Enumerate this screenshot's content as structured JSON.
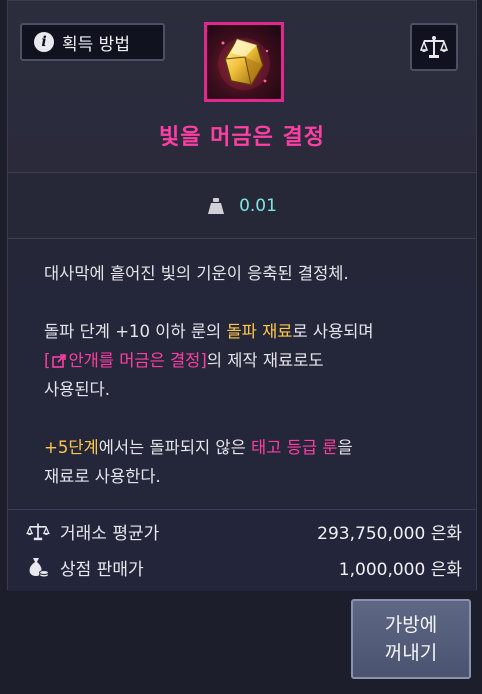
{
  "header": {
    "acquire_label": "획득 방법",
    "item_name": "빛을 머금은 결정"
  },
  "icons": {
    "info": "info-icon",
    "scale": "scale-icon",
    "weight": "weight-icon",
    "coin_bag": "coin-bag-icon",
    "external_link": "external-link-icon"
  },
  "weight": {
    "value": "0.01"
  },
  "description": {
    "line1": "대사막에 흩어진 빛의 기운이 응축된 결정체.",
    "p2_a": "돌파 단계 +10 이하 룬의 ",
    "p2_b": "돌파 재료",
    "p2_c": "로 사용되며",
    "p2_link_open": "[",
    "p2_link": "안개를 머금은 결정",
    "p2_link_close": "]",
    "p2_d": "의 제작 재료로도",
    "p2_e": "사용된다.",
    "p3_a": "+5단계",
    "p3_b": "에서는 돌파되지 않은 ",
    "p3_c": "태고 등급 룬",
    "p3_d": "을",
    "p3_e": "재료로 사용한다."
  },
  "prices": {
    "market_label": "거래소 평균가",
    "market_value": "293,750,000 은화",
    "shop_label": "상점 판매가",
    "shop_value": "1,000,000 은화"
  },
  "actions": {
    "take_out_line1": "가방에",
    "take_out_line2": "꺼내기"
  },
  "colors": {
    "accent_pink": "#ff3fa4",
    "accent_yellow": "#ffc94a",
    "weight_cyan": "#7fe3e0"
  }
}
